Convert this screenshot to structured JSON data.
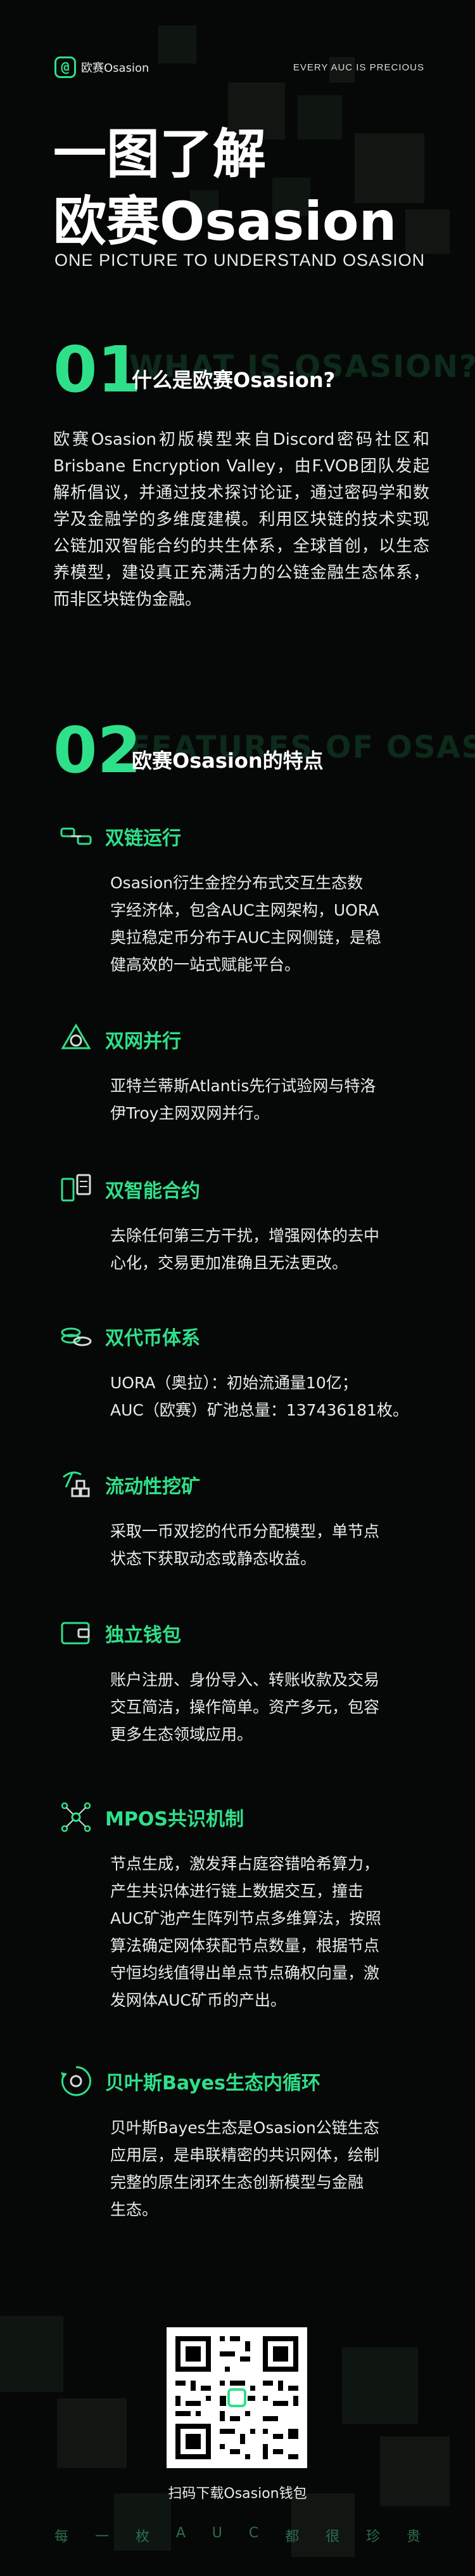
{
  "header": {
    "logo_mark": "@",
    "logo_text": "欧赛Osasion",
    "tagline": "EVERY AUC IS PRECIOUS"
  },
  "hero": {
    "title_line1": "一图了解",
    "title_line2": "欧赛Osasion",
    "subtitle": "ONE PICTURE TO UNDERSTAND OSASION"
  },
  "section1": {
    "number": "01",
    "ghost": "WHAT IS OSASION?",
    "title": "什么是欧赛Osasion?",
    "body": "欧赛Osasion初版模型来自Discord密码社区和Brisbane Encryption Valley，由F.VOB团队发起解析倡议，并通过技术探讨论证，通过密码学和数学及金融学的多维度建模。利用区块链的技术实现公链加双智能合约的共生体系，全球首创，以生态养模型，建设真正充满活力的公链金融生态体系，而非区块链伪金融。"
  },
  "section2": {
    "number": "02",
    "ghost": "FEATURES OF OSASION",
    "title": "欧赛Osasion的特点"
  },
  "features": [
    {
      "icon": "chain-link-icon",
      "title": "双链运行",
      "lines": [
        "Osasion衍生金控分布式交互生态数",
        "字经济体，包含AUC主网架构，UORA",
        "奥拉稳定币分布于AUC主网侧链，是稳",
        "健高效的一站式赋能平台。"
      ]
    },
    {
      "icon": "network-icon",
      "title": "双网并行",
      "lines": [
        "亚特兰蒂斯Atlantis先行试验网与特洛",
        "伊Troy主网双网并行。"
      ]
    },
    {
      "icon": "smart-contract-icon",
      "title": "双智能合约",
      "lines": [
        "去除任何第三方干扰，增强网体的去中",
        "心化，交易更加准确且无法更改。"
      ]
    },
    {
      "icon": "coins-icon",
      "title": "双代币体系",
      "lines": [
        "UORA（奥拉）：初始流通量10亿；",
        "AUC（欧赛）矿池总量：137436181枚。"
      ]
    },
    {
      "icon": "pickaxe-icon",
      "title": "流动性挖矿",
      "lines": [
        "采取一币双挖的代币分配模型，单节点",
        "状态下获取动态或静态收益。"
      ]
    },
    {
      "icon": "wallet-icon",
      "title": "独立钱包",
      "lines": [
        "账户注册、身份导入、转账收款及交易",
        "交互简洁，操作简单。资产多元，包容",
        "更多生态领域应用。"
      ]
    },
    {
      "icon": "consensus-network-icon",
      "title": "MPOS共识机制",
      "lines": [
        "节点生成，激发拜占庭容错哈希算力，",
        "产生共识体进行链上数据交互，撞击",
        "AUC矿池产生阵列节点多维算法，按照",
        "算法确定网体获配节点数量，根据节点",
        "守恒均线值得出单点节点确权向量，激",
        "发网体AUC矿币的产出。"
      ]
    },
    {
      "icon": "cycle-icon",
      "title": "贝叶斯Bayes生态内循环",
      "lines": [
        "贝叶斯Bayes生态是Osasion公链生态",
        "应用层，是串联精密的共识网体，绘制",
        "完整的原生闭环生态创新模型与金融",
        "生态。"
      ]
    }
  ],
  "qr": {
    "caption": "扫码下载Osasion钱包"
  },
  "footer": {
    "chars": [
      "每",
      "一",
      "枚",
      "A",
      "U",
      "C",
      "都",
      "很",
      "珍",
      "贵"
    ]
  },
  "colors": {
    "accent": "#2fe08a",
    "background": "#060807"
  }
}
